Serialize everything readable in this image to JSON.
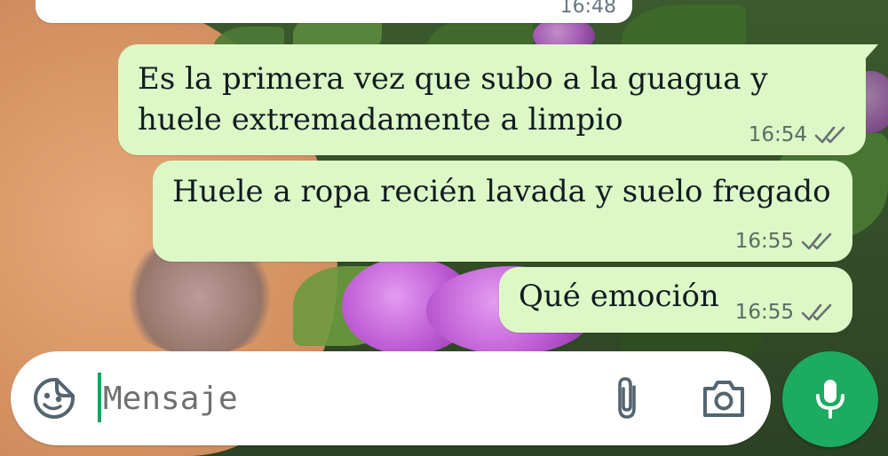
{
  "chat": {
    "incoming_partial": {
      "time": "16:48"
    },
    "messages": [
      {
        "lines": [
          "Es la primera vez que subo a la guagua y",
          "huele extremadamente a limpio"
        ],
        "time": "16:54",
        "status": "read"
      },
      {
        "text": "Huele a ropa recién lavada y suelo fregado",
        "time": "16:55",
        "status": "read"
      },
      {
        "text": "Qué emoción",
        "time": "16:55",
        "status": "read"
      }
    ]
  },
  "composer": {
    "placeholder": "Mensaje",
    "value": "",
    "icons": {
      "emoji": "sticker-smile-icon",
      "attach": "paperclip-icon",
      "camera": "camera-icon",
      "mic": "microphone-icon"
    }
  },
  "colors": {
    "outgoing_bubble": "#dcf8c6",
    "incoming_bubble": "#ffffff",
    "accent_green": "#1daa61",
    "meta_text": "#5d6b63"
  }
}
